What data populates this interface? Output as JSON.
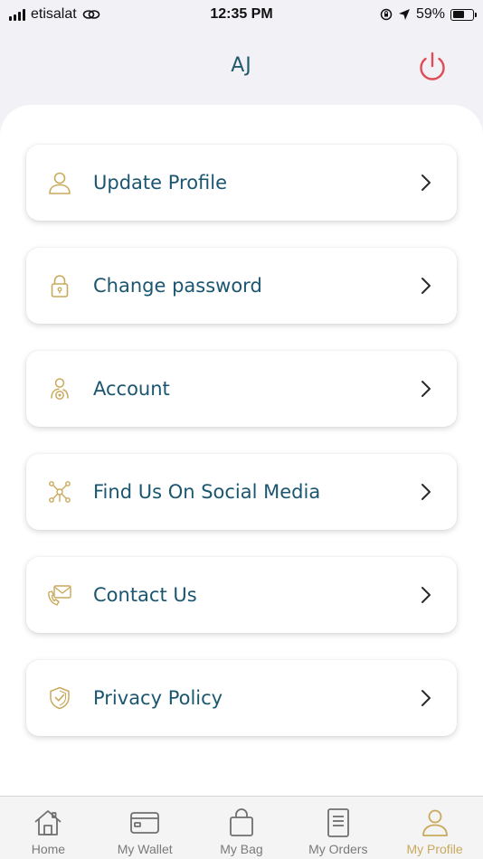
{
  "status_bar": {
    "carrier": "etisalat",
    "time": "12:35 PM",
    "battery": "59%",
    "battery_level": 0.59
  },
  "header": {
    "title": "AJ",
    "power_icon": "power-icon",
    "power_color": "#e04b55"
  },
  "colors": {
    "accent_gold": "#c9a95c",
    "text_teal": "#1b5670"
  },
  "menu": [
    {
      "label": "Update Profile",
      "icon": "user-icon"
    },
    {
      "label": "Change password",
      "icon": "lock-icon"
    },
    {
      "label": "Account",
      "icon": "account-settings-icon"
    },
    {
      "label": "Find Us On Social Media",
      "icon": "network-icon"
    },
    {
      "label": "Contact Us",
      "icon": "mail-phone-icon"
    },
    {
      "label": "Privacy Policy",
      "icon": "shield-check-icon"
    }
  ],
  "tab_bar": {
    "tabs": [
      {
        "label": "Home",
        "icon": "home-icon"
      },
      {
        "label": "My Wallet",
        "icon": "wallet-icon"
      },
      {
        "label": "My Bag",
        "icon": "bag-icon"
      },
      {
        "label": "My Orders",
        "icon": "orders-icon"
      },
      {
        "label": "My Profile",
        "icon": "profile-icon"
      }
    ],
    "active": "My Profile"
  }
}
